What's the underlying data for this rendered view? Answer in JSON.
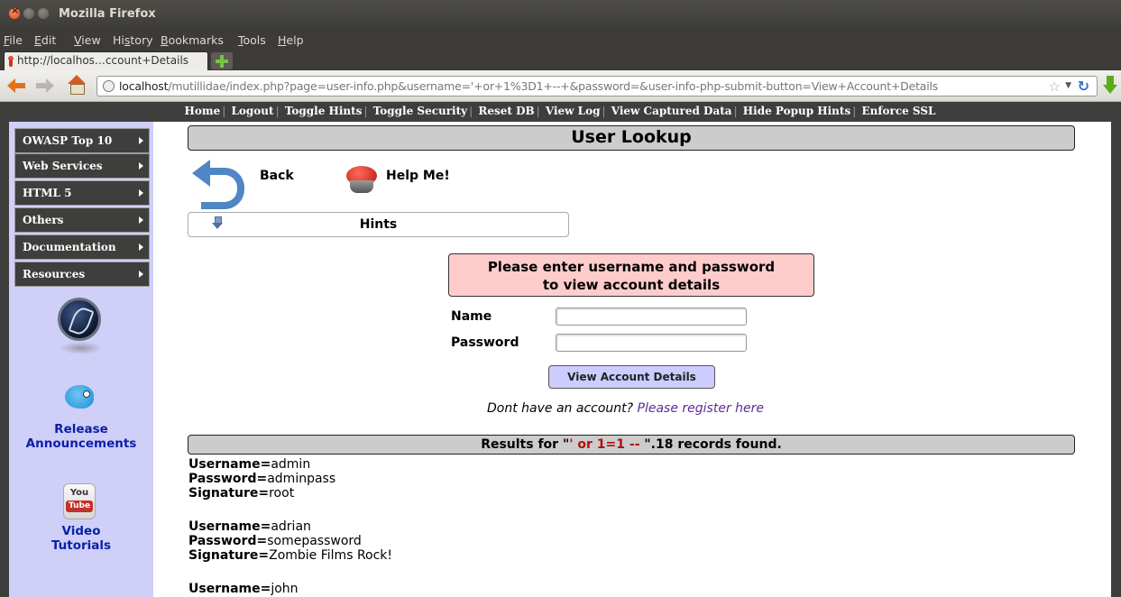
{
  "window": {
    "title": "Mozilla Firefox"
  },
  "menubar": [
    {
      "u": "F",
      "rest": "ile"
    },
    {
      "u": "E",
      "rest": "dit"
    },
    {
      "u": "V",
      "rest": "iew"
    },
    {
      "u": "",
      "rest": "Hi",
      "u2": "s",
      "rest2": "tory"
    },
    {
      "u": "B",
      "rest": "ookmarks"
    },
    {
      "u": "T",
      "rest": "ools"
    },
    {
      "u": "H",
      "rest": "elp"
    }
  ],
  "tab": {
    "label": "http://localhos…ccount+Details"
  },
  "urlbar": {
    "host": "localhost",
    "path": "/mutillidae/index.php?page=user-info.php&username='+or+1%3D1+--+&password=&user-info-php-submit-button=View+Account+Details"
  },
  "topnav": [
    "Home",
    "Logout",
    "Toggle Hints",
    "Toggle Security",
    "Reset DB",
    "View Log",
    "View Captured Data",
    "Hide Popup Hints",
    "Enforce SSL"
  ],
  "sidebar": {
    "items": [
      "OWASP Top 10",
      "Web Services",
      "HTML 5",
      "Others",
      "Documentation",
      "Resources"
    ],
    "release_line1": "Release",
    "release_line2": "Announcements",
    "yt_you": "You",
    "yt_tube": "Tube",
    "video_line1": "Video",
    "video_line2": "Tutorials"
  },
  "main": {
    "title": "User Lookup",
    "back_label": "Back",
    "help_label": "Help Me!",
    "hints_label": "Hints",
    "prompt_line1": "Please enter username and password",
    "prompt_line2": "to view account details",
    "name_label": "Name",
    "password_label": "Password",
    "name_value": "",
    "password_value": "",
    "submit_label": "View Account Details",
    "register_text": "Dont have an account? ",
    "register_link": "Please register here"
  },
  "results": {
    "prefix": "Results for \"",
    "injection": "' or 1=1 --",
    "suffix": " \".18 records found.",
    "records": [
      {
        "username": "admin",
        "password": "adminpass",
        "signature": "root"
      },
      {
        "username": "adrian",
        "password": "somepassword",
        "signature": "Zombie Films Rock!"
      },
      {
        "username": "john",
        "password": "",
        "signature": ""
      }
    ],
    "labels": {
      "username": "Username=",
      "password": "Password=",
      "signature": "Signature="
    }
  },
  "colors": {
    "chrome_dark": "#3c3b37",
    "sidebar_bg": "#cfcff8",
    "prompt_bg": "#ffcccc",
    "button_bg": "#ccccff",
    "link": "#0a1fa8",
    "injection": "#b01010"
  }
}
